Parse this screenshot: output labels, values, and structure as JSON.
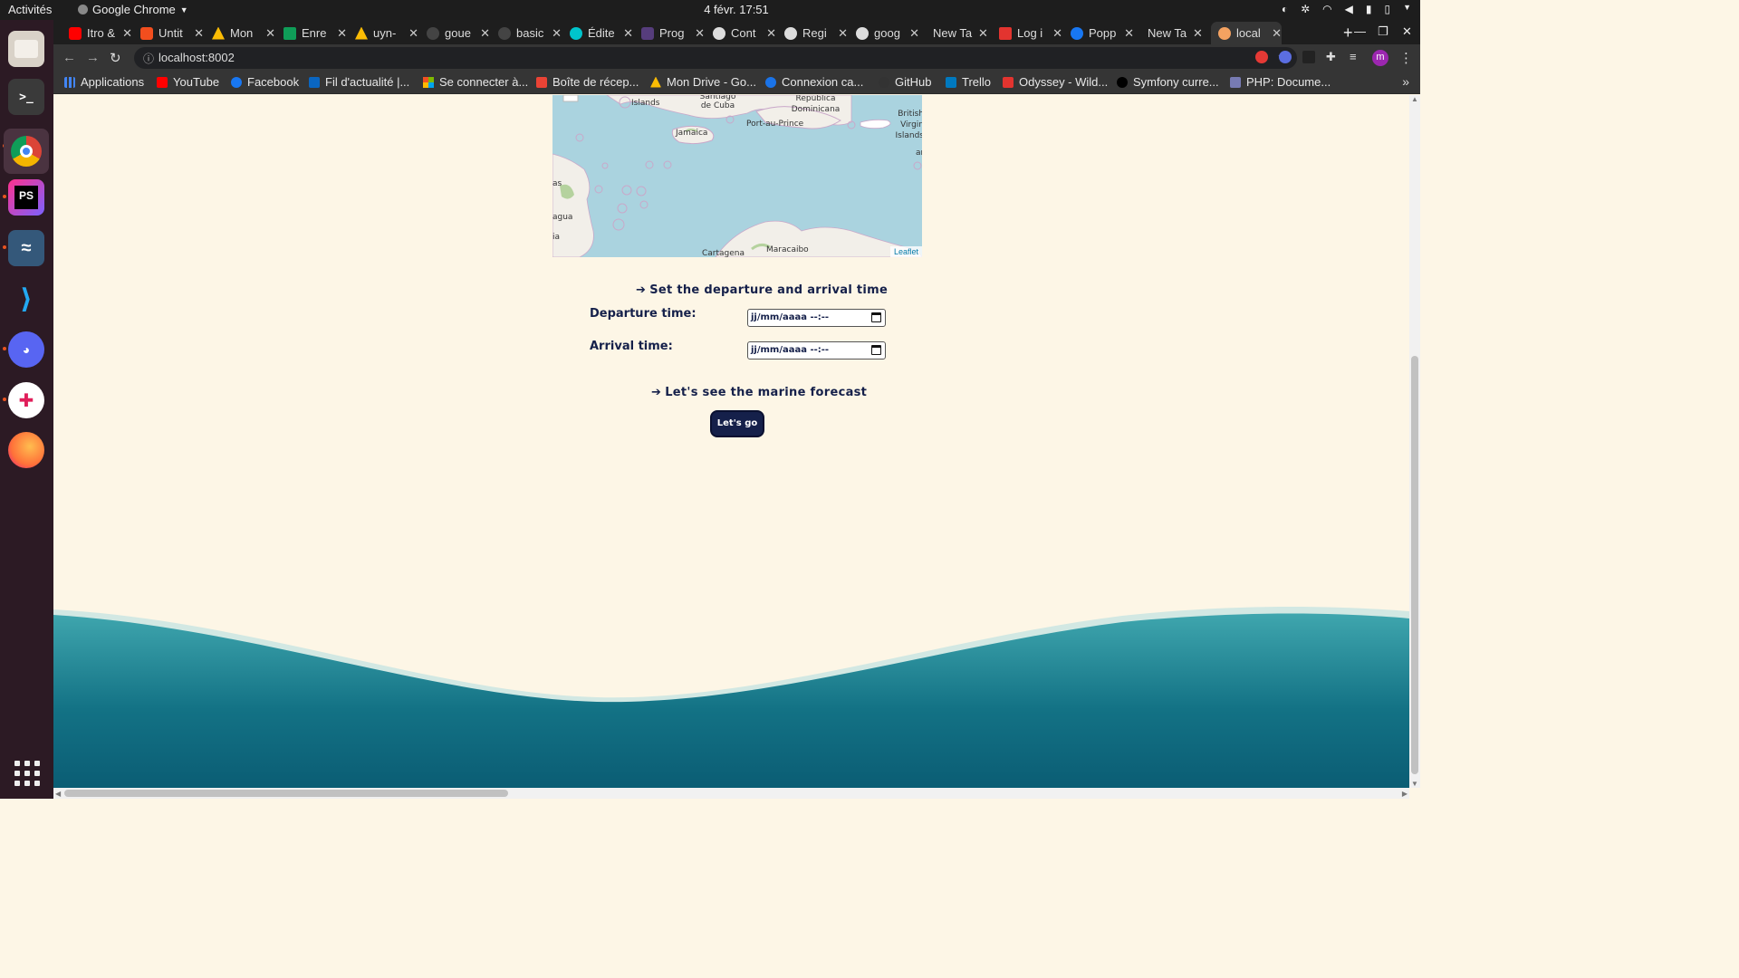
{
  "system": {
    "activities": "Activités",
    "app_name": "Google Chrome",
    "clock": "4 févr.  17:51"
  },
  "tabs": [
    {
      "label": "Itro &",
      "icon_color": "#ff0000"
    },
    {
      "label": "Untit",
      "icon_color": "#f24e1e"
    },
    {
      "label": "Mon",
      "icon_color": "#fbbc04"
    },
    {
      "label": "Enre",
      "icon_color": "#0f9d58"
    },
    {
      "label": "uyn-",
      "icon_color": "#fbbc04"
    },
    {
      "label": "goue",
      "icon_color": "#444444"
    },
    {
      "label": "basic",
      "icon_color": "#444444"
    },
    {
      "label": "Édite",
      "icon_color": "#00c4cc"
    },
    {
      "label": "Prog",
      "icon_color": "#563d7c"
    },
    {
      "label": "Cont",
      "icon_color": "#dddddd"
    },
    {
      "label": "Regi",
      "icon_color": "#dddddd"
    },
    {
      "label": "goog",
      "icon_color": "#dddddd"
    },
    {
      "label": "New Tab",
      "icon_color": ""
    },
    {
      "label": "Log i",
      "icon_color": "#e3342f"
    },
    {
      "label": "Popp",
      "icon_color": "#1877f2"
    },
    {
      "label": "New Tab",
      "icon_color": ""
    },
    {
      "label": "local",
      "icon_color": "#f4a261"
    }
  ],
  "address_bar": {
    "url": "localhost:8002"
  },
  "bookmarks": [
    {
      "label": "Applications",
      "icon_color": "#4285f4"
    },
    {
      "label": "YouTube",
      "icon_color": "#ff0000"
    },
    {
      "label": "Facebook",
      "icon_color": "#1877f2"
    },
    {
      "label": "Fil d'actualité |...",
      "icon_color": "#0a66c2"
    },
    {
      "label": "Se connecter à...",
      "icon_color": "#f25022"
    },
    {
      "label": "Boîte de récep...",
      "icon_color": "#ea4335"
    },
    {
      "label": "Mon Drive - Go...",
      "icon_color": "#fbbc04"
    },
    {
      "label": "Connexion ca...",
      "icon_color": "#1a73e8"
    },
    {
      "label": "GitHub",
      "icon_color": "#333333"
    },
    {
      "label": "Trello",
      "icon_color": "#0079bf"
    },
    {
      "label": "Odyssey - Wild...",
      "icon_color": "#e3342f"
    },
    {
      "label": "Symfony curre...",
      "icon_color": "#000000"
    },
    {
      "label": "PHP: Docume...",
      "icon_color": "#777bb3"
    }
  ],
  "map": {
    "labels": [
      "Islands",
      "Santiago de Cuba",
      "República Dominicana",
      "Port-au-Prince",
      "British Virgin Islands",
      "Jamaica",
      "agua",
      "Cartagena",
      "Maracaibo",
      "ar",
      "as",
      "ia"
    ],
    "attribution": "Leaflet"
  },
  "form": {
    "time_heading": "Set the departure and arrival time",
    "departure_label": "Departure time:",
    "departure_value": "jj/mm/aaaa --:--",
    "arrival_label": "Arrival time:",
    "arrival_value": "jj/mm/aaaa --:--",
    "forecast_heading": "Let's see the marine forecast",
    "go_button": "Let's go"
  },
  "colors": {
    "page_background": "#fdf6e6",
    "heading_text": "#15204a",
    "button_bg": "#15204a",
    "wave_light": "#3fa6ae",
    "wave_dark": "#0b5d74",
    "map_sea": "#aad3df"
  }
}
